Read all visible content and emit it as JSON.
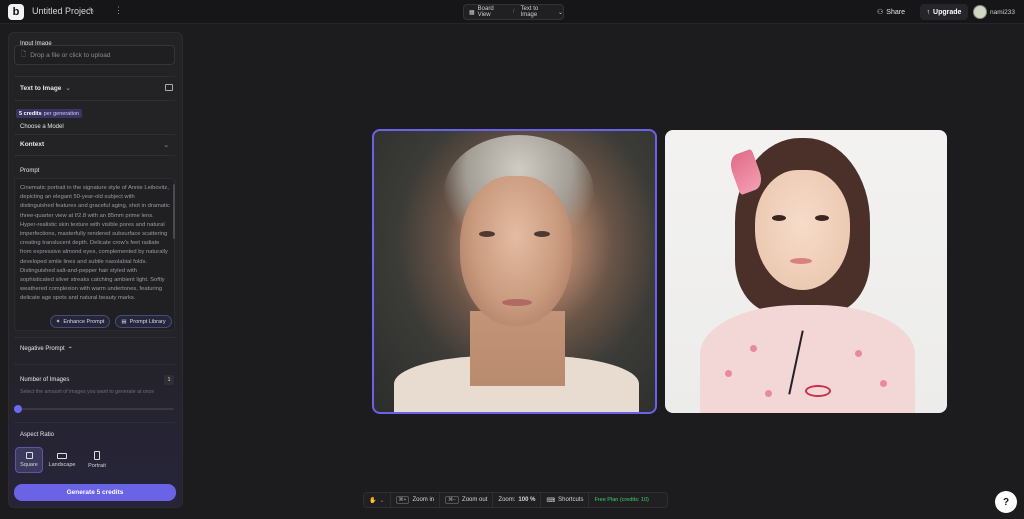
{
  "header": {
    "logo_text": "b",
    "project_title": "Untitled Project",
    "view_label": "Board View",
    "mode_label": "Text to Image",
    "share_label": "Share",
    "upgrade_label": "Upgrade",
    "username": "nami233"
  },
  "panel": {
    "input_image_label": "Input Image",
    "upload_placeholder": "Drop a file or click to upload",
    "mode_select": "Text to Image",
    "credits_amount": "5 credits",
    "credits_suffix": "per generation",
    "choose_model_label": "Choose a Model",
    "model_value": "Kontext",
    "prompt_label": "Prompt",
    "prompt_text": "Cinematic portrait in the signature style of Annie Leibovitz, depicting an elegant 50-year-old subject with distinguished features and graceful aging, shot in dramatic three-quarter view at f/2.8 with an 85mm prime lens. Hyper-realistic skin texture with visible pores and natural imperfections, masterfully rendered subsurface scattering creating translucent depth. Delicate crow's feet radiate from expressive almond eyes, complemented by naturally developed smile lines and subtle nasolabial folds. Distinguished salt-and-pepper hair styled with sophisticated silver streaks catching ambient light. Softly weathered complexion with warm undertones, featuring delicate age spots and natural beauty marks.",
    "enhance_prompt_label": "Enhance Prompt",
    "prompt_library_label": "Prompt Library",
    "negative_prompt_label": "Negative Prompt",
    "number_of_images_label": "Number of Images",
    "number_of_images_value": "1",
    "number_of_images_hint": "Select the amount of images you want to generate at once",
    "aspect_ratio_label": "Aspect Ratio",
    "aspect_options": [
      {
        "label": "Square",
        "selected": true
      },
      {
        "label": "Landscape",
        "selected": false
      },
      {
        "label": "Portrait",
        "selected": false
      }
    ],
    "generate_label": "Generate 5 credits"
  },
  "bottom_bar": {
    "zoom_in_label": "Zoom in",
    "zoom_out_label": "Zoom out",
    "zoom_label": "Zoom:",
    "zoom_value": "100 %",
    "shortcuts_label": "Shortcuts",
    "plan_label": "Free Plan (credits: 10)"
  },
  "help_label": "?",
  "colors": {
    "accent": "#6b63e6",
    "plan_green": "#3ecf6a",
    "background": "#1c1c1e"
  }
}
